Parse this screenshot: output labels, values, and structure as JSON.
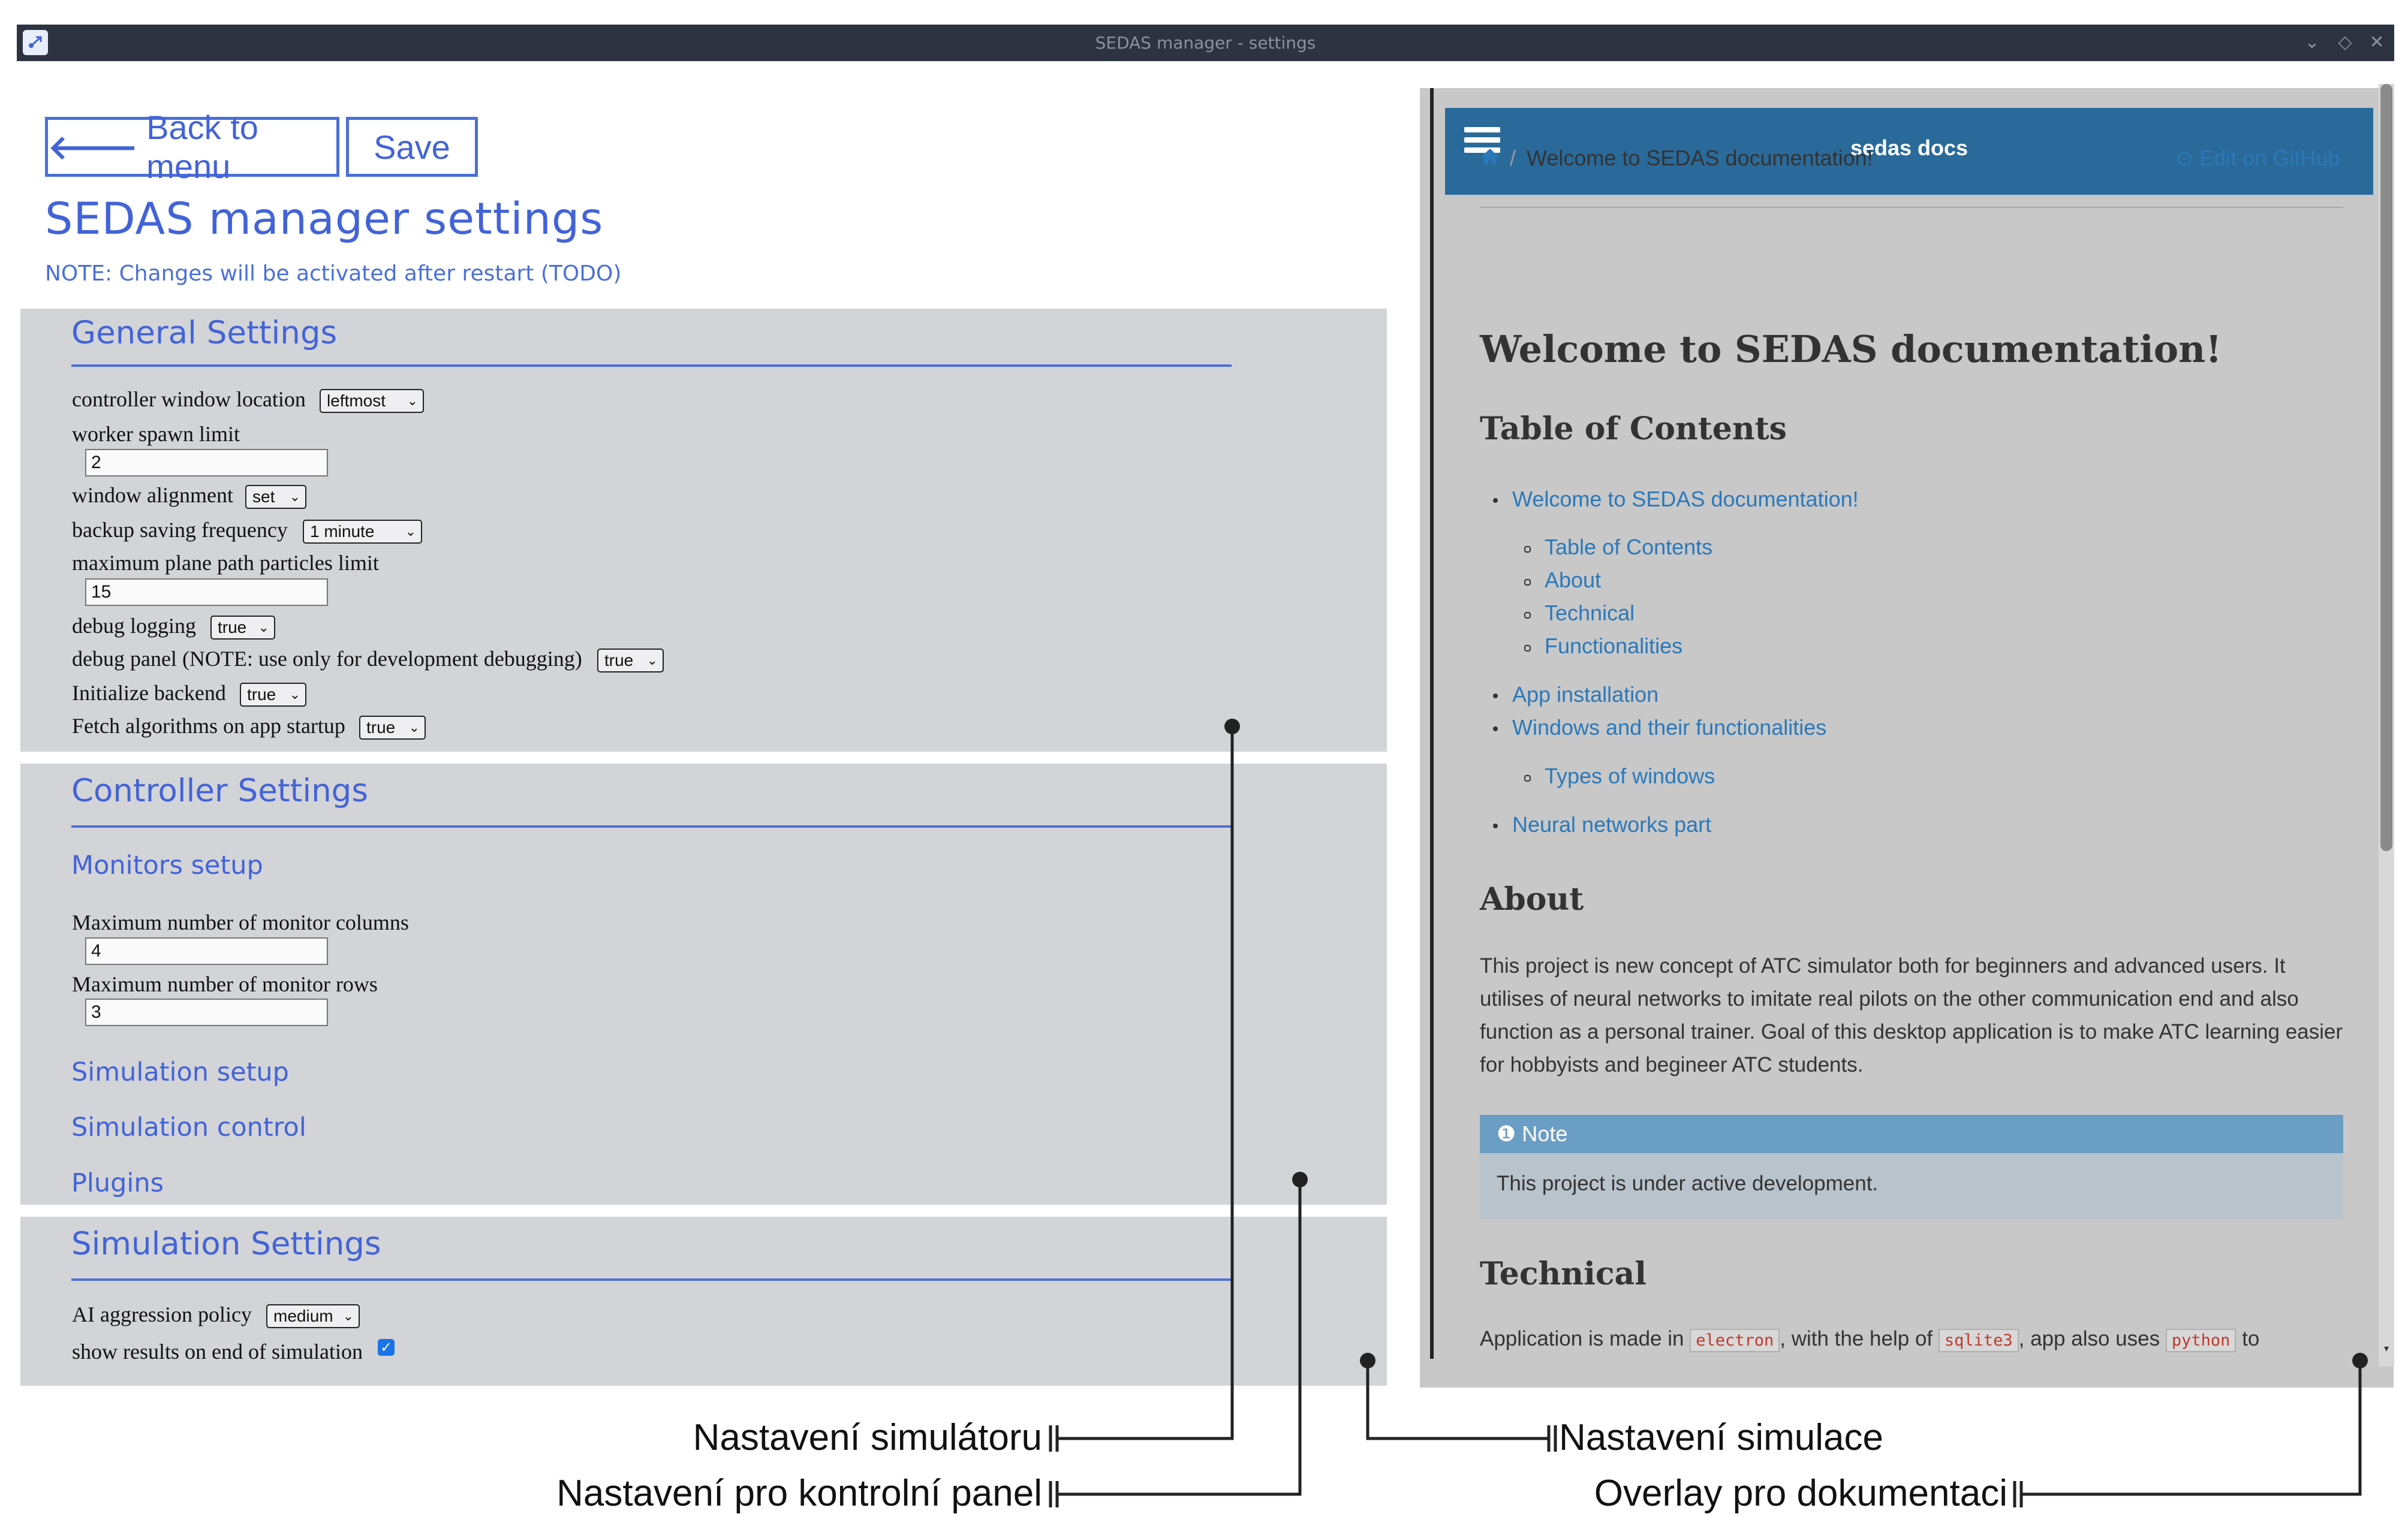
{
  "window": {
    "title": "SEDAS manager - settings"
  },
  "toolbar": {
    "back_label": "Back to menu",
    "save_label": "Save"
  },
  "page": {
    "title": "SEDAS manager settings",
    "note": "NOTE: Changes will be activated after restart (TODO)"
  },
  "general": {
    "title": "General Settings",
    "controller_window_location": {
      "label": "controller window location",
      "value": "leftmost"
    },
    "worker_spawn_limit": {
      "label": "worker spawn limit",
      "value": "2"
    },
    "window_alignment": {
      "label": "window alignment",
      "value": "set"
    },
    "backup_saving_frequency": {
      "label": "backup saving frequency",
      "value": "1 minute"
    },
    "max_plane_path_particles": {
      "label": "maximum plane path particles limit",
      "value": "15"
    },
    "debug_logging": {
      "label": "debug logging",
      "value": "true"
    },
    "debug_panel": {
      "label": "debug panel (NOTE: use only for development debugging)",
      "value": "true"
    },
    "initialize_backend": {
      "label": "Initialize backend",
      "value": "true"
    },
    "fetch_algorithms": {
      "label": "Fetch algorithms on app startup",
      "value": "true"
    }
  },
  "controller": {
    "title": "Controller Settings",
    "monitors_setup": "Monitors setup",
    "max_columns": {
      "label": "Maximum number of monitor columns",
      "value": "4"
    },
    "max_rows": {
      "label": "Maximum number of monitor rows",
      "value": "3"
    },
    "simulation_setup": "Simulation setup",
    "simulation_control": "Simulation control",
    "plugins": "Plugins"
  },
  "simulation": {
    "title": "Simulation Settings",
    "ai_aggression": {
      "label": "AI aggression policy",
      "value": "medium"
    },
    "show_results": {
      "label": "show results on end of simulation",
      "checked": true
    }
  },
  "docs": {
    "brand": "sedas docs",
    "breadcrumb_sep": "/",
    "breadcrumb": "Welcome to SEDAS documentation!",
    "edit_link": "Edit on GitHub",
    "h1": "Welcome to SEDAS documentation!",
    "toc_title": "Table of Contents",
    "toc": {
      "welcome": "Welcome to SEDAS documentation!",
      "toc": "Table of Contents",
      "about": "About",
      "technical": "Technical",
      "functionalities": "Functionalities",
      "app_installation": "App installation",
      "windows": "Windows and their functionalities",
      "types_of_windows": "Types of windows",
      "neural": "Neural networks part"
    },
    "about_title": "About",
    "about_para": "This project is new concept of ATC simulator both for beginners and advanced users. It utilises of neural networks to imitate real pilots on the other communication end and also function as a personal trainer. Goal of this desktop application is to make ATC learning easier for hobbyists and begineer ATC students.",
    "note_title": "Note",
    "note_body": "This project is under active development.",
    "technical_title": "Technical",
    "technical_line": {
      "t1": "Application is made in",
      "c1": "electron",
      "t2": ", with the help of",
      "c2": "sqlite3",
      "t3": ", app also uses",
      "c3": "python",
      "t4": "to"
    }
  },
  "annotations": {
    "simulator": "Nastavení simulátoru",
    "control_panel": "Nastavení pro kontrolní panel",
    "simulation": "Nastavení simulace",
    "docs_overlay": "Overlay pro dokumentaci"
  },
  "colors": {
    "accent": "#4263d8",
    "panel": "#d3d4d7",
    "docs_header": "#2a6a9a",
    "titlebar": "#2d3340"
  },
  "icons": [
    "app-icon",
    "arrow-left-icon",
    "chevron-down-icon",
    "check-icon",
    "menu-icon",
    "home-icon",
    "github-icon",
    "info-icon"
  ]
}
